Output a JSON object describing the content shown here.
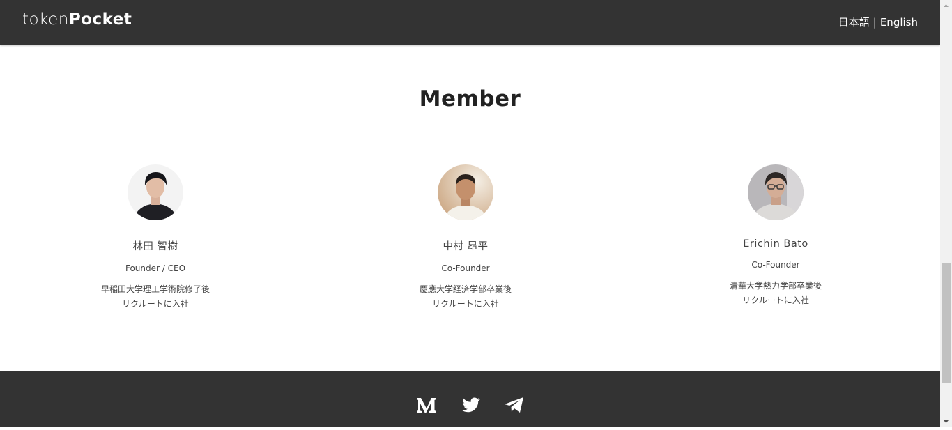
{
  "header": {
    "logo_light": "token",
    "logo_bold": "Pocket",
    "lang_ja": "日本語",
    "lang_sep": "|",
    "lang_en": "English"
  },
  "section": {
    "title": "Member"
  },
  "members": [
    {
      "name": "林田 智樹",
      "role": "Founder / CEO",
      "bio_line1": "早稲田大学理工学術院修了後",
      "bio_line2": "リクルートに入社"
    },
    {
      "name": "中村 昂平",
      "role": "Co-Founder",
      "bio_line1": "慶應大学経済学部卒業後",
      "bio_line2": "リクルートに入社"
    },
    {
      "name": "Erichin Bato",
      "role": "Co-Founder",
      "bio_line1": "清華大学熱力学部卒業後",
      "bio_line2": "リクルートに入社"
    }
  ],
  "footer": {
    "icons": [
      "medium-icon",
      "twitter-icon",
      "telegram-icon"
    ]
  },
  "colors": {
    "header_bg": "#333333",
    "footer_bg": "#333333",
    "text": "#333333"
  }
}
